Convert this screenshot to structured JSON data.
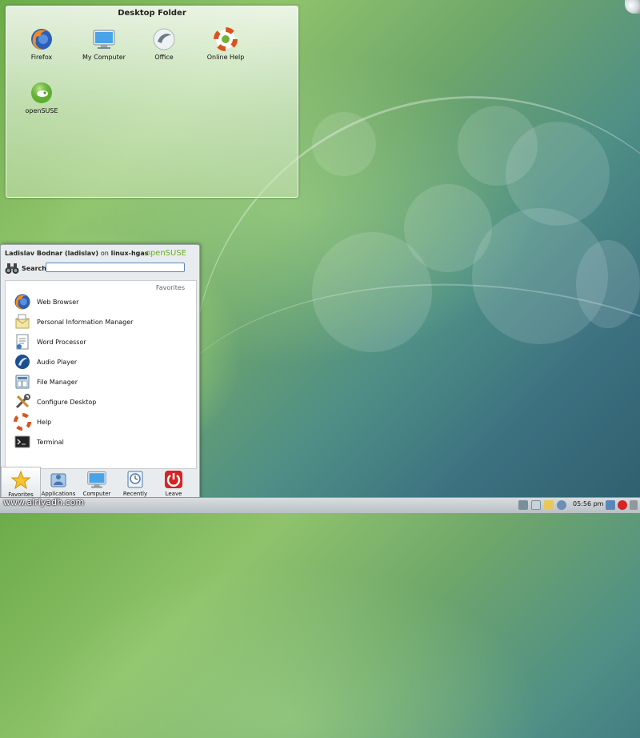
{
  "desktop_folder": {
    "title": "Desktop Folder",
    "icons": [
      {
        "label": "Firefox",
        "icon": "firefox-icon"
      },
      {
        "label": "My Computer",
        "icon": "monitor-icon"
      },
      {
        "label": "Office",
        "icon": "office-icon"
      },
      {
        "label": "Online Help",
        "icon": "lifebuoy-icon"
      },
      {
        "label": "openSUSE",
        "icon": "opensuse-icon"
      }
    ]
  },
  "launcher": {
    "user": "Ladislav Bodnar (ladislav)",
    "on_text": "on",
    "host": "linux-hgas",
    "brand": "openSUSE",
    "search_label": "Search:",
    "search_value": "",
    "favorites_header": "Favorites",
    "favorites": [
      {
        "label": "Web Browser",
        "icon": "firefox-icon"
      },
      {
        "label": "Personal Information Manager",
        "icon": "pim-icon"
      },
      {
        "label": "Word Processor",
        "icon": "word-processor-icon"
      },
      {
        "label": "Audio Player",
        "icon": "audio-player-icon"
      },
      {
        "label": "File Manager",
        "icon": "file-manager-icon"
      },
      {
        "label": "Configure Desktop",
        "icon": "configure-icon"
      },
      {
        "label": "Help",
        "icon": "lifebuoy-icon"
      },
      {
        "label": "Terminal",
        "icon": "terminal-icon"
      }
    ],
    "tabs": [
      {
        "label": "Favorites",
        "icon": "star-icon",
        "active": true
      },
      {
        "label": "Applications",
        "icon": "applications-icon"
      },
      {
        "label": "Computer",
        "icon": "computer-icon"
      },
      {
        "label": "Recently Used",
        "icon": "clock-icon"
      },
      {
        "label": "Leave",
        "icon": "power-icon"
      }
    ]
  },
  "taskbar": {
    "watermark": "www.alriyadh.com",
    "clock": "05:56 pm"
  },
  "colors": {
    "brand_green": "#6aaa2a",
    "search_border": "#5a87b8",
    "leave_red": "#d42424"
  }
}
